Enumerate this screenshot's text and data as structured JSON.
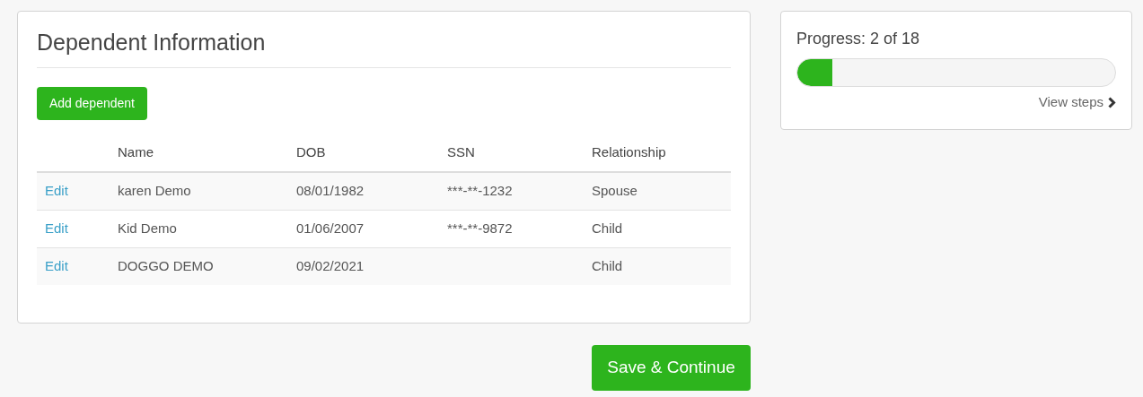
{
  "dependents": {
    "title": "Dependent Information",
    "add_button": "Add dependent",
    "table": {
      "columns": [
        "",
        "Name",
        "DOB",
        "SSN",
        "Relationship"
      ],
      "rows": [
        {
          "action": "Edit",
          "name": "karen Demo",
          "dob": "08/01/1982",
          "ssn": "***-**-1232",
          "relationship": "Spouse"
        },
        {
          "action": "Edit",
          "name": "Kid Demo",
          "dob": "01/06/2007",
          "ssn": "***-**-9872",
          "relationship": "Child"
        },
        {
          "action": "Edit",
          "name": "DOGGO DEMO",
          "dob": "09/02/2021",
          "relationship": "Child"
        }
      ]
    }
  },
  "progress": {
    "label": "Progress: 2 of 18",
    "level": 0.111,
    "link": "View steps"
  },
  "save_button": "Save & Continue"
}
